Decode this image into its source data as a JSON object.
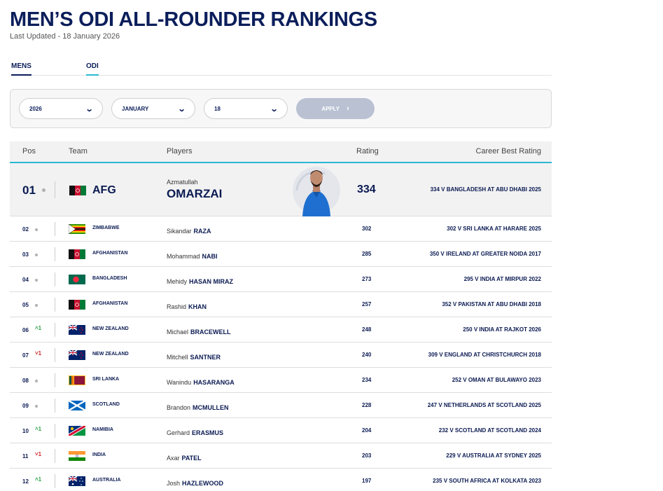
{
  "page": {
    "title": "MEN’S ODI ALL-ROUNDER RANKINGS",
    "updated": "Last Updated - 18 January 2026"
  },
  "tabs": {
    "mens": "MENS",
    "odi": "ODI"
  },
  "filters": {
    "year": "2026",
    "month": "JANUARY",
    "day": "18",
    "apply": "APPLY"
  },
  "table": {
    "headers": {
      "pos": "Pos",
      "team": "Team",
      "players": "Players",
      "rating": "Rating",
      "best": "Career Best Rating"
    },
    "top": {
      "pos": "01",
      "team": "AFG",
      "first": "Azmatullah",
      "last": "OMARZAI",
      "rating": "334",
      "best": "334 V BANGLADESH AT ABU DHABI 2025",
      "flag": "afghanistan-flag-icon"
    },
    "rows": [
      {
        "pos": "02",
        "mv": "same",
        "mv_text": "",
        "team": "ZIMBABWE",
        "flag": "zimbabwe",
        "first": "Sikandar",
        "last": "RAZA",
        "rating": "302",
        "best": "302 V SRI LANKA AT HARARE 2025"
      },
      {
        "pos": "03",
        "mv": "same",
        "mv_text": "",
        "team": "AFGHANISTAN",
        "flag": "afghanistan",
        "first": "Mohammad",
        "last": "NABI",
        "rating": "285",
        "best": "350 V IRELAND AT GREATER NOIDA 2017"
      },
      {
        "pos": "04",
        "mv": "same",
        "mv_text": "",
        "team": "BANGLADESH",
        "flag": "bangladesh",
        "first": "Mehidy",
        "last": "HASAN MIRAZ",
        "rating": "273",
        "best": "295 V INDIA AT MIRPUR 2022"
      },
      {
        "pos": "05",
        "mv": "same",
        "mv_text": "",
        "team": "AFGHANISTAN",
        "flag": "afghanistan",
        "first": "Rashid",
        "last": "KHAN",
        "rating": "257",
        "best": "352 V PAKISTAN AT ABU DHABI 2018"
      },
      {
        "pos": "06",
        "mv": "up",
        "mv_text": "^1",
        "team": "NEW ZEALAND",
        "flag": "newzealand",
        "first": "Michael",
        "last": "BRACEWELL",
        "rating": "248",
        "best": "250 V INDIA AT RAJKOT 2026"
      },
      {
        "pos": "07",
        "mv": "down",
        "mv_text": "v1",
        "team": "NEW ZEALAND",
        "flag": "newzealand",
        "first": "Mitchell",
        "last": "SANTNER",
        "rating": "240",
        "best": "309 V ENGLAND AT CHRISTCHURCH 2018"
      },
      {
        "pos": "08",
        "mv": "same",
        "mv_text": "",
        "team": "SRI LANKA",
        "flag": "srilanka",
        "first": "Wanindu",
        "last": "HASARANGA",
        "rating": "234",
        "best": "252 V OMAN AT BULAWAYO 2023"
      },
      {
        "pos": "09",
        "mv": "same",
        "mv_text": "",
        "team": "SCOTLAND",
        "flag": "scotland",
        "first": "Brandon",
        "last": "MCMULLEN",
        "rating": "228",
        "best": "247 V NETHERLANDS AT SCOTLAND 2025"
      },
      {
        "pos": "10",
        "mv": "up",
        "mv_text": "^1",
        "team": "NAMIBIA",
        "flag": "namibia",
        "first": "Gerhard",
        "last": "ERASMUS",
        "rating": "204",
        "best": "232 V SCOTLAND AT SCOTLAND 2024"
      },
      {
        "pos": "11",
        "mv": "down",
        "mv_text": "v1",
        "team": "INDIA",
        "flag": "india",
        "first": "Axar",
        "last": "PATEL",
        "rating": "203",
        "best": "229 V AUSTRALIA AT SYDNEY 2025"
      },
      {
        "pos": "12",
        "mv": "up",
        "mv_text": "^1",
        "team": "AUSTRALIA",
        "flag": "australia",
        "first": "Josh",
        "last": "HAZLEWOOD",
        "rating": "197",
        "best": "235 V SOUTH AFRICA AT KOLKATA 2023"
      }
    ]
  }
}
